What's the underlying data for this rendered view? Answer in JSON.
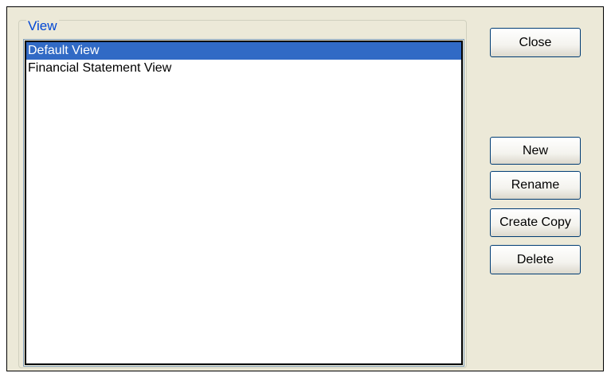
{
  "group": {
    "label": "View"
  },
  "list": {
    "items": [
      {
        "label": "Default View",
        "selected": true
      },
      {
        "label": "Financial Statement View",
        "selected": false
      }
    ]
  },
  "buttons": {
    "close": "Close",
    "new": "New",
    "rename": "Rename",
    "create_copy": "Create Copy",
    "delete": "Delete"
  },
  "colors": {
    "selection": "#316ac5",
    "group_label": "#0046d5",
    "dialog_background": "#ece9d8"
  }
}
